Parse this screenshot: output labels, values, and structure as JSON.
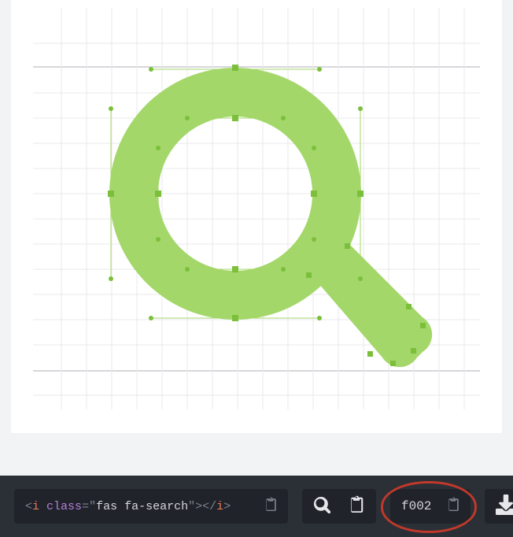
{
  "preview": {
    "icon_semantic": "search-icon",
    "fill_color": "#a4d76a"
  },
  "footer": {
    "code": {
      "punc1": "<",
      "tag": "i",
      "space1": " ",
      "attr": "class",
      "eq": "=",
      "q1": "\"",
      "val": "fas fa-search",
      "q2": "\"",
      "punc2": ">",
      "punc3": "</",
      "tag2": "i",
      "punc4": ">"
    },
    "unicode": "f002"
  }
}
